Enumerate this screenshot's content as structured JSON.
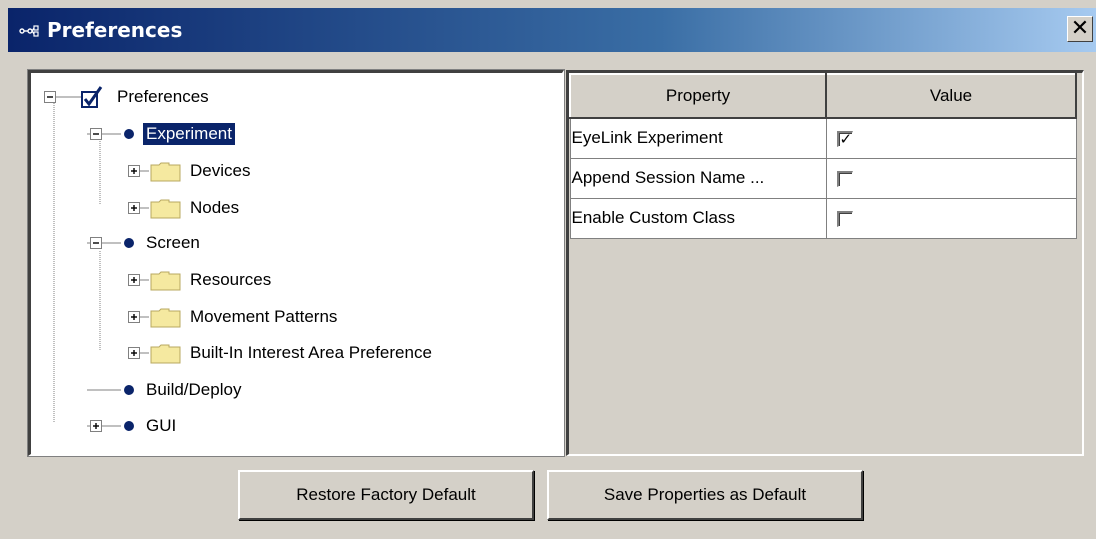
{
  "window": {
    "title": "Preferences",
    "close_glyph": "✕",
    "title_icon": "network-nodes-icon"
  },
  "tree": {
    "root": {
      "label": "Preferences",
      "icon": "checkbox-checked-icon",
      "expanded": true
    },
    "items": [
      {
        "label": "Experiment",
        "icon": "bullet-icon",
        "expanded": true,
        "selected": true
      },
      {
        "label": "Devices",
        "icon": "folder-icon",
        "expanded": false
      },
      {
        "label": "Nodes",
        "icon": "folder-icon",
        "expanded": false
      },
      {
        "label": "Screen",
        "icon": "bullet-icon",
        "expanded": true
      },
      {
        "label": "Resources",
        "icon": "folder-icon",
        "expanded": false
      },
      {
        "label": "Movement Patterns",
        "icon": "folder-icon",
        "expanded": false
      },
      {
        "label": "Built-In Interest Area Preference",
        "icon": "folder-icon",
        "expanded": false
      },
      {
        "label": "Build/Deploy",
        "icon": "bullet-icon",
        "expanded": false
      },
      {
        "label": "GUI",
        "icon": "bullet-icon",
        "expanded": false
      }
    ]
  },
  "properties": {
    "headers": [
      "Property",
      "Value"
    ],
    "rows": [
      {
        "property": "EyeLink Experiment",
        "checked": true
      },
      {
        "property": "Append Session Name ...",
        "checked": false
      },
      {
        "property": "Enable Custom Class",
        "checked": false
      }
    ]
  },
  "buttons": {
    "restore": "Restore Factory Default",
    "save": "Save Properties as Default"
  },
  "colors": {
    "selection": "#0a246a",
    "titlebar_start": "#0a246a",
    "titlebar_end": "#a6caf0",
    "bullet": "#0a246a",
    "folder": "#f5e9a0"
  }
}
